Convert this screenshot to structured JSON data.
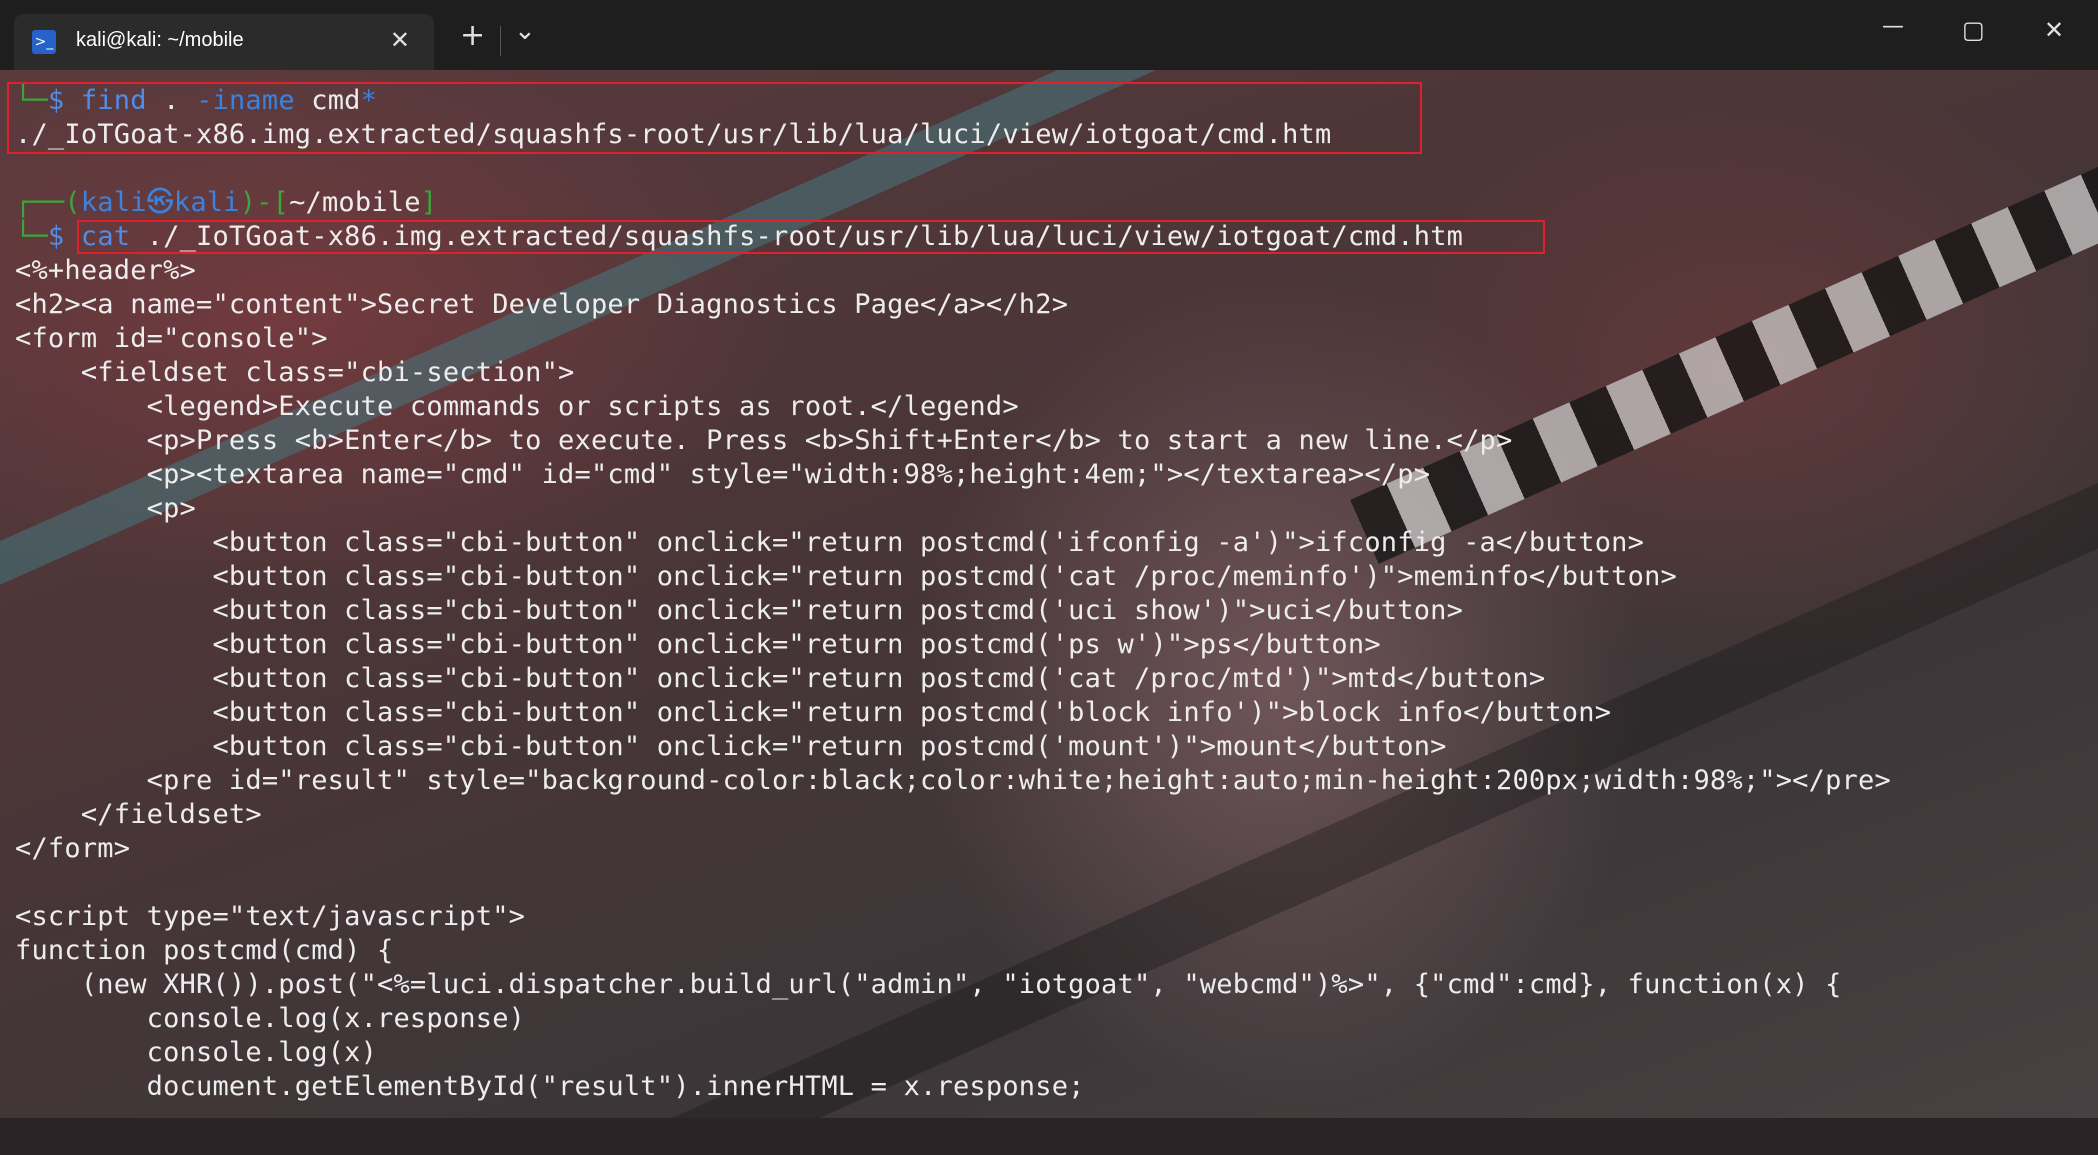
{
  "window": {
    "tab_title": "kali@kali: ~/mobile",
    "tab_icon": "powershell-icon",
    "new_tab_label": "+",
    "dropdown_label": "⌄",
    "minimize_label": "—",
    "maximize_label": "▢",
    "close_label": "✕"
  },
  "prompt": {
    "user": "kali",
    "at_icon": "㉿",
    "host": "kali",
    "path": "~/mobile",
    "dollar": "$"
  },
  "commands": {
    "find_cmd": "find",
    "find_args1": " . ",
    "find_flag": "-iname",
    "find_pattern": " cmd",
    "find_star": "*",
    "find_result": "./_IoTGoat-x86.img.extracted/squashfs-root/usr/lib/lua/luci/view/iotgoat/cmd.htm",
    "cat_cmd": "cat",
    "cat_arg": " ./_IoTGoat-x86.img.extracted/squashfs-root/usr/lib/lua/luci/view/iotgoat/cmd.htm"
  },
  "output_lines": [
    "<%+header%>",
    "<h2><a name=\"content\">Secret Developer Diagnostics Page</a></h2>",
    "<form id=\"console\">",
    "    <fieldset class=\"cbi-section\">",
    "        <legend>Execute commands or scripts as root.</legend>",
    "        <p>Press <b>Enter</b> to execute. Press <b>Shift+Enter</b> to start a new line.</p>",
    "        <p><textarea name=\"cmd\" id=\"cmd\" style=\"width:98%;height:4em;\"></textarea></p>",
    "        <p>",
    "            <button class=\"cbi-button\" onclick=\"return postcmd('ifconfig -a')\">ifconfig -a</button>",
    "            <button class=\"cbi-button\" onclick=\"return postcmd('cat /proc/meminfo')\">meminfo</button>",
    "            <button class=\"cbi-button\" onclick=\"return postcmd('uci show')\">uci</button>",
    "            <button class=\"cbi-button\" onclick=\"return postcmd('ps w')\">ps</button>",
    "            <button class=\"cbi-button\" onclick=\"return postcmd('cat /proc/mtd')\">mtd</button>",
    "            <button class=\"cbi-button\" onclick=\"return postcmd('block info')\">block info</button>",
    "            <button class=\"cbi-button\" onclick=\"return postcmd('mount')\">mount</button>",
    "        <pre id=\"result\" style=\"background-color:black;color:white;height:auto;min-height:200px;width:98%;\"></pre>",
    "    </fieldset>",
    "</form>",
    "",
    "<script type=\"text/javascript\">",
    "function postcmd(cmd) {",
    "    (new XHR()).post(\"<%=luci.dispatcher.build_url(\"admin\", \"iotgoat\", \"webcmd\")%>\", {\"cmd\":cmd}, function(x) {",
    "        console.log(x.response)",
    "        console.log(x)",
    "        document.getElementById(\"result\").innerHTML = x.response;"
  ],
  "colors": {
    "prompt_green": "#3ca53c",
    "prompt_blue": "#3a82e0",
    "highlight_red": "#e0202a"
  }
}
